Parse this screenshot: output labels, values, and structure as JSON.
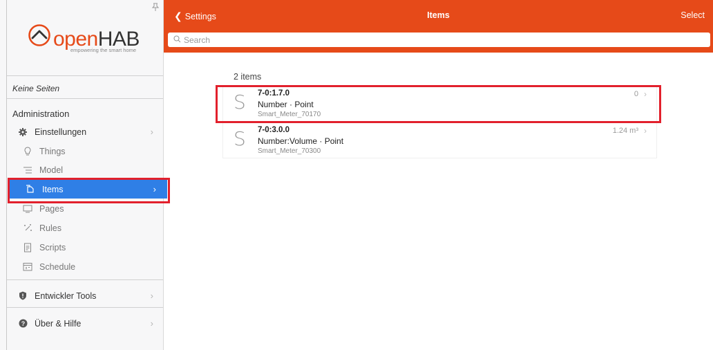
{
  "sidebar": {
    "pin_icon": "pin-icon",
    "logo": {
      "brand_prefix": "open",
      "brand_suffix": "HAB",
      "tagline": "empowering the smart home"
    },
    "no_pages": "Keine Seiten",
    "section": "Administration",
    "settings": {
      "label": "Einstellungen",
      "icon": "gear-icon"
    },
    "sub_items": [
      {
        "label": "Things",
        "icon": "lightbulb-icon"
      },
      {
        "label": "Model",
        "icon": "list-icon"
      },
      {
        "label": "Items",
        "icon": "items-icon"
      },
      {
        "label": "Pages",
        "icon": "monitor-icon"
      },
      {
        "label": "Rules",
        "icon": "wand-icon"
      },
      {
        "label": "Scripts",
        "icon": "document-icon"
      },
      {
        "label": "Schedule",
        "icon": "calendar-icon"
      }
    ],
    "dev_tools": {
      "label": "Entwickler Tools",
      "icon": "shield-icon"
    },
    "help": {
      "label": "Über & Hilfe",
      "icon": "help-icon"
    }
  },
  "header": {
    "back_label": "Settings",
    "title": "Items",
    "select_label": "Select",
    "search_placeholder": "Search"
  },
  "content": {
    "count": "2 items",
    "items": [
      {
        "letter": "S",
        "name": "7-0:1.7.0",
        "type": "Number · Point",
        "thing": "Smart_Meter_70170",
        "state": "0"
      },
      {
        "letter": "S",
        "name": "7-0:3.0.0",
        "type": "Number:Volume · Point",
        "thing": "Smart_Meter_70300",
        "state": "1.24 m³"
      }
    ]
  },
  "colors": {
    "header": "#e64a19",
    "active": "#2f7fe6",
    "highlight": "#e2202c"
  }
}
